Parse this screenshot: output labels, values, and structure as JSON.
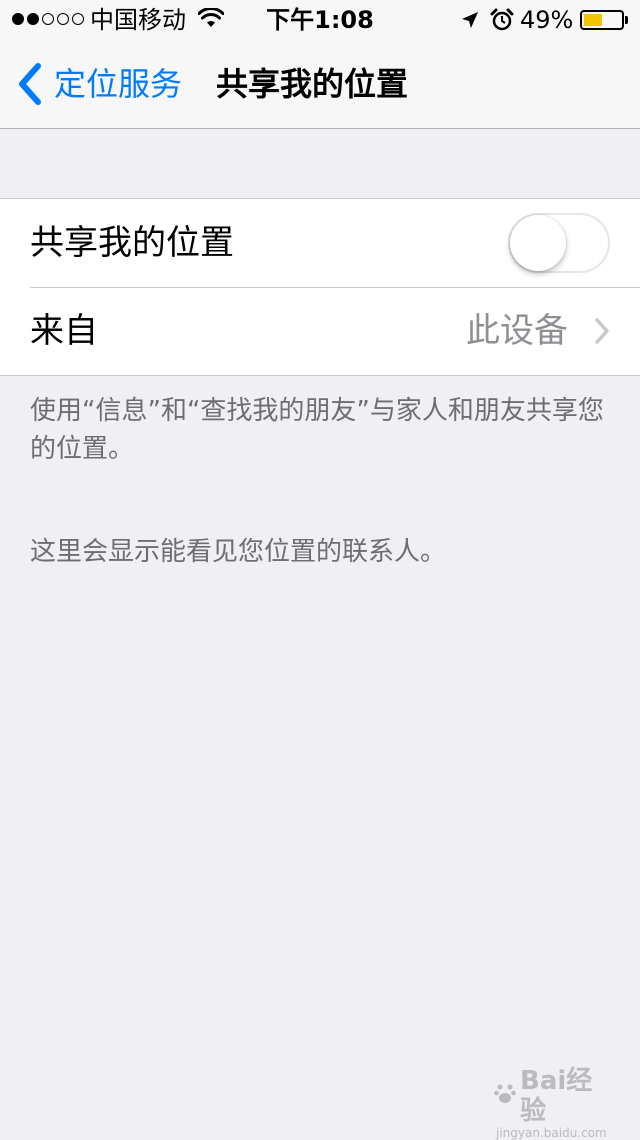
{
  "status_bar": {
    "signal_bars_filled": 2,
    "signal_bars_total": 5,
    "carrier": "中国移动",
    "time": "下午1:08",
    "battery_percent_text": "49%",
    "battery_level": 0.49,
    "battery_color": "#f5c400",
    "icons": [
      "wifi-icon",
      "location-arrow-icon",
      "alarm-icon",
      "battery-icon"
    ]
  },
  "nav": {
    "back_label": "定位服务",
    "title": "共享我的位置",
    "accent_color": "#007aff"
  },
  "settings": {
    "share_location": {
      "label": "共享我的位置",
      "enabled": false
    },
    "from": {
      "label": "来自",
      "value": "此设备"
    }
  },
  "footer": {
    "description": "使用“信息”和“查找我的朋友”与家人和朋友共享您的位置。",
    "contacts_note": "这里会显示能看见您位置的联系人。"
  },
  "watermark": {
    "logo_text": "Bai经验",
    "url": "jingyan.baidu.com"
  }
}
